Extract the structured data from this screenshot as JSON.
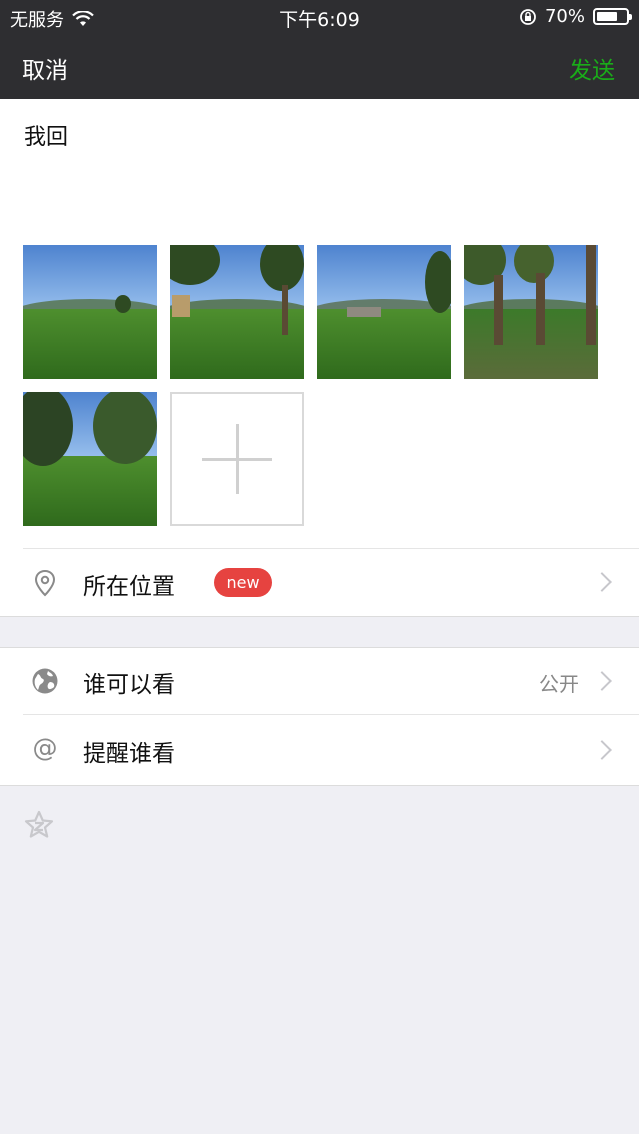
{
  "status_bar": {
    "carrier": "无服务",
    "time": "下午6:09",
    "battery": "70%",
    "battery_level": 0.7
  },
  "nav": {
    "cancel_label": "取消",
    "send_label": "发送"
  },
  "compose": {
    "text": "我回"
  },
  "photos": [
    {
      "name": "photo-1"
    },
    {
      "name": "photo-2"
    },
    {
      "name": "photo-3"
    },
    {
      "name": "photo-4"
    },
    {
      "name": "photo-5"
    }
  ],
  "location": {
    "label": "所在位置",
    "badge": "new"
  },
  "visibility": {
    "label": "谁可以看",
    "value": "公开"
  },
  "mention": {
    "label": "提醒谁看"
  },
  "colors": {
    "nav_bg": "#2e2e31",
    "send_green": "#1aad19",
    "badge_red": "#e64340",
    "page_bg": "#efeff4"
  },
  "icons": {
    "location": "location-pin-icon",
    "visibility": "globe-icon",
    "mention": "at-icon",
    "footer": "star-icon"
  }
}
